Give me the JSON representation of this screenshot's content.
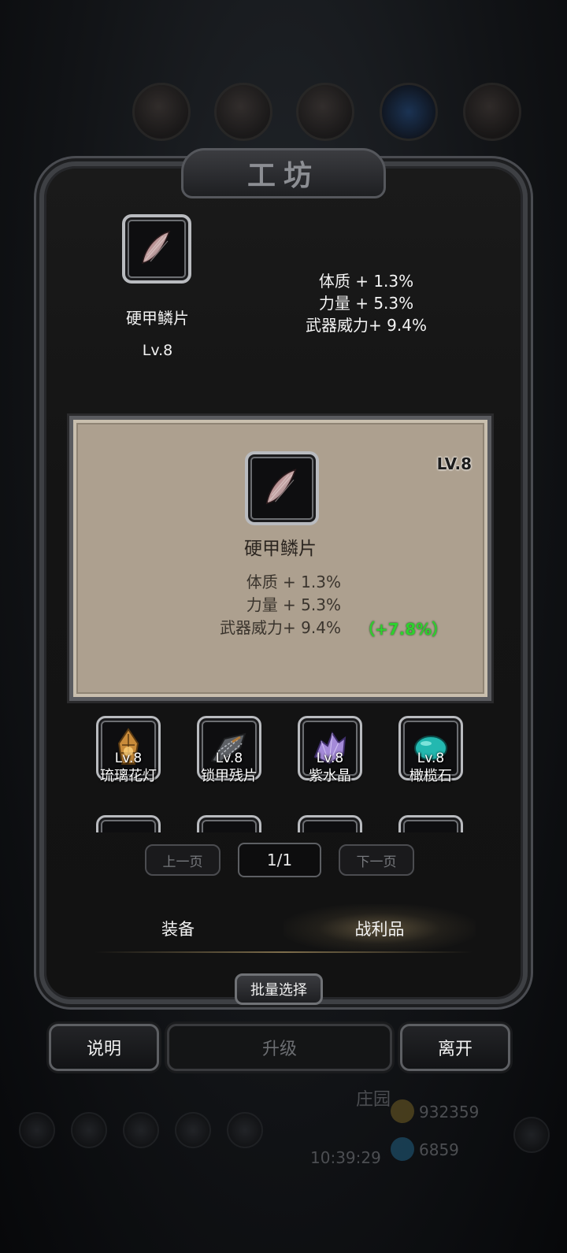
{
  "window": {
    "title": "工坊"
  },
  "selected": {
    "name": "硬甲鳞片",
    "level_label": "Lv.8",
    "stats": [
      "体质 + 1.3%",
      "力量 + 5.3%",
      "武器威力+ 9.4%"
    ]
  },
  "detail": {
    "level_label": "LV.8",
    "name": "硬甲鳞片",
    "stats": [
      "体质 + 1.3%",
      "力量 + 5.3%",
      "武器威力+ 9.4%"
    ],
    "bonus": "（+7.8%）",
    "bonus_color": "#2ed12e"
  },
  "items": [
    {
      "level": "Lv.8",
      "name": "琉璃花灯",
      "icon": "lantern-icon"
    },
    {
      "level": "Lv.8",
      "name": "锁甲残片",
      "icon": "chainmail-fragment-icon"
    },
    {
      "level": "Lv.8",
      "name": "紫水晶",
      "icon": "amethyst-icon"
    },
    {
      "level": "Lv.8",
      "name": "橄榄石",
      "icon": "olivine-icon"
    }
  ],
  "pager": {
    "prev": "上一页",
    "current": "1/1",
    "next": "下一页"
  },
  "tabs": [
    {
      "label": "装备",
      "active": false
    },
    {
      "label": "战利品",
      "active": true
    }
  ],
  "batch_select": "批量选择",
  "buttons": {
    "help": "说明",
    "upgrade": "升级",
    "leave": "离开"
  },
  "background": {
    "resource_1": "932359",
    "resource_2": "6859",
    "clock": "10:39:29",
    "label": "庄园"
  }
}
